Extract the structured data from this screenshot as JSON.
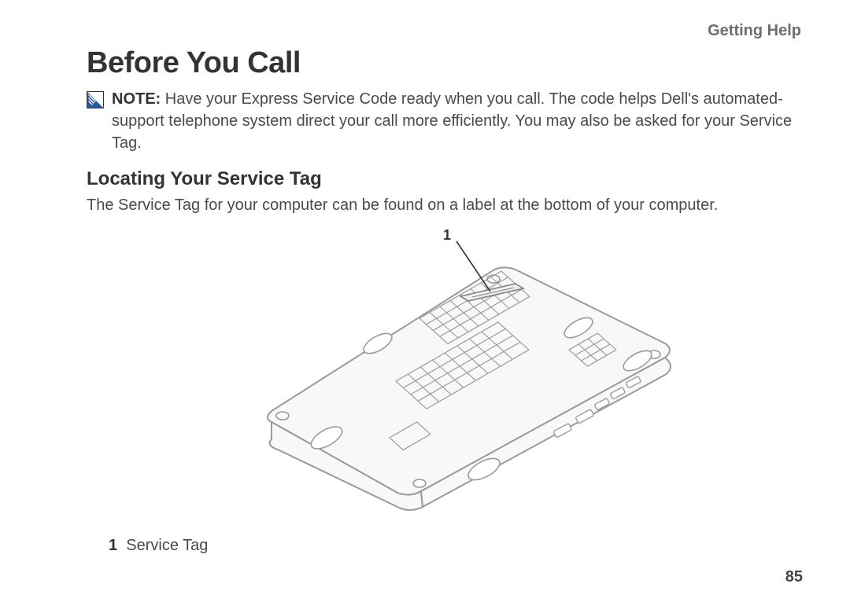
{
  "header": {
    "section": "Getting Help"
  },
  "title": "Before You Call",
  "note": {
    "label": "NOTE:",
    "text": "Have your Express Service Code ready when you call. The code helps Dell's automated-support telephone system direct your call more efficiently. You may also be asked for your Service Tag."
  },
  "subheading": "Locating Your Service Tag",
  "body": "The Service Tag for your computer can be found on a label at the bottom of your computer.",
  "figure": {
    "callout_number": "1",
    "legend_number": "1",
    "legend_text": "Service Tag"
  },
  "page_number": "85"
}
